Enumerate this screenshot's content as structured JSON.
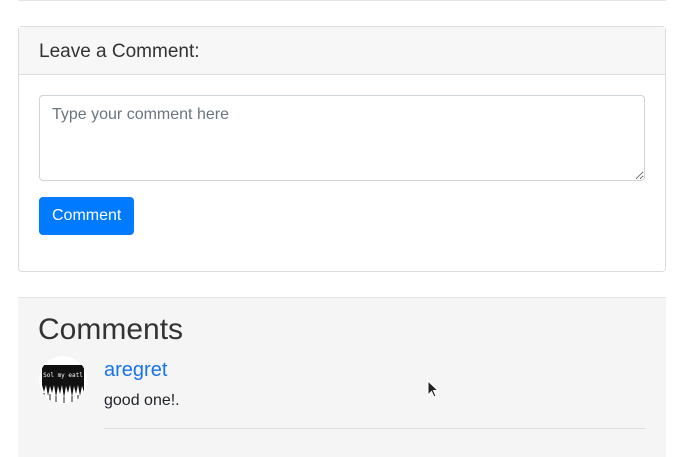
{
  "comment_form": {
    "header": "Leave a Comment:",
    "textarea_placeholder": "Type your comment here",
    "submit_label": "Comment"
  },
  "comments": {
    "title": "Comments",
    "items": [
      {
        "author": "aregret",
        "text": "good one!.",
        "avatar": "avatar-image"
      }
    ]
  },
  "colors": {
    "primary": "#007bff",
    "link": "#1a73e8",
    "section_bg": "#f5f5f5",
    "card_header_bg": "#f7f7f7"
  },
  "icons": {
    "cursor": "mouse-pointer-icon"
  }
}
